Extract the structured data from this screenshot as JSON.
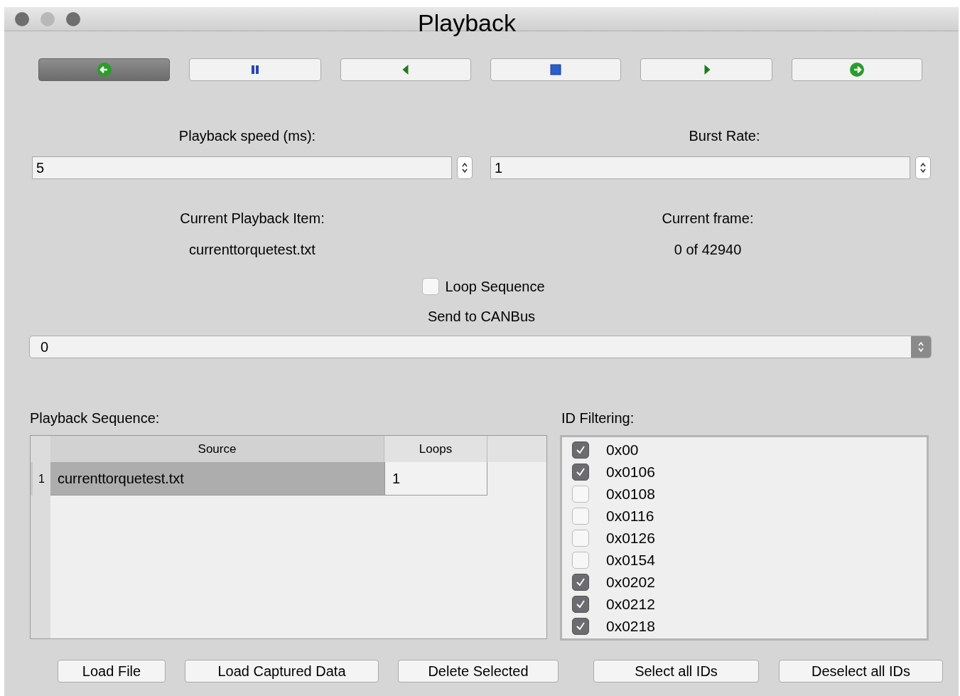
{
  "window": {
    "title": "Playback"
  },
  "toolbar": [
    {
      "kind": "back",
      "selected": true
    },
    {
      "kind": "pause",
      "selected": false
    },
    {
      "kind": "prev",
      "selected": false
    },
    {
      "kind": "stop",
      "selected": false
    },
    {
      "kind": "next",
      "selected": false
    },
    {
      "kind": "forward",
      "selected": false
    }
  ],
  "playback_speed": {
    "label": "Playback speed (ms):",
    "value": "5"
  },
  "burst_rate": {
    "label": "Burst Rate:",
    "value": "1"
  },
  "current_item": {
    "label": "Current Playback Item:",
    "value": "currenttorquetest.txt"
  },
  "current_frame": {
    "label": "Current frame:",
    "value": "0 of 42940"
  },
  "loop_sequence": {
    "label": "Loop Sequence",
    "checked": false
  },
  "send_to_canbus": {
    "label": "Send to CANBus",
    "value": "0"
  },
  "playback_sequence": {
    "label": "Playback Sequence:",
    "columns": [
      "Source",
      "Loops"
    ],
    "rows": [
      {
        "index": "1",
        "source": "currenttorquetest.txt",
        "loops": "1",
        "selected": true
      }
    ]
  },
  "id_filtering": {
    "label": "ID Filtering:",
    "items": [
      {
        "id": "0x00",
        "checked": true
      },
      {
        "id": "0x0106",
        "checked": true
      },
      {
        "id": "0x0108",
        "checked": false
      },
      {
        "id": "0x0116",
        "checked": false
      },
      {
        "id": "0x0126",
        "checked": false
      },
      {
        "id": "0x0154",
        "checked": false
      },
      {
        "id": "0x0202",
        "checked": true
      },
      {
        "id": "0x0212",
        "checked": true
      },
      {
        "id": "0x0218",
        "checked": true
      }
    ]
  },
  "buttons": [
    "Load File",
    "Load Captured Data",
    "Delete Selected",
    "Select all IDs",
    "Deselect all IDs"
  ]
}
